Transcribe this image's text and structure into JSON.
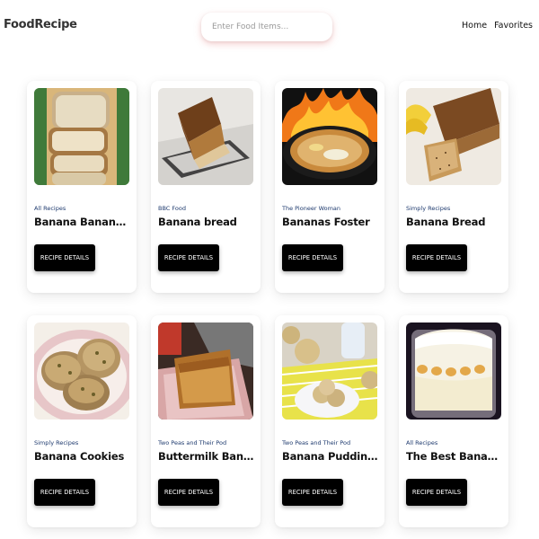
{
  "header": {
    "brand": "FoodRecipe",
    "search_placeholder": "Enter Food Items...",
    "nav": [
      "Home",
      "Favorites"
    ]
  },
  "recipes": [
    {
      "source": "All Recipes",
      "title": "Banana Banana Bread",
      "button": "RECIPE DETAILS",
      "image": "bread-slices"
    },
    {
      "source": "BBC Food",
      "title": "Banana bread",
      "button": "RECIPE DETAILS",
      "image": "loaf-on-rack"
    },
    {
      "source": "The Pioneer Woman",
      "title": "Bananas Foster",
      "button": "RECIPE DETAILS",
      "image": "flambe-skillet"
    },
    {
      "source": "Simply Recipes",
      "title": "Banana Bread",
      "button": "RECIPE DETAILS",
      "image": "sliced-loaf"
    },
    {
      "source": "Simply Recipes",
      "title": "Banana Cookies",
      "button": "RECIPE DETAILS",
      "image": "cookies-plate"
    },
    {
      "source": "Two Peas and Their Pod",
      "title": "Buttermilk Banana Br...",
      "button": "RECIPE DETAILS",
      "image": "loaf-on-napkin"
    },
    {
      "source": "Two Peas and Their Pod",
      "title": "Banana Pudding Cook...",
      "button": "RECIPE DETAILS",
      "image": "cookies-on-plate"
    },
    {
      "source": "All Recipes",
      "title": "The Best Banana Pud...",
      "button": "RECIPE DETAILS",
      "image": "pudding-trifle"
    }
  ]
}
